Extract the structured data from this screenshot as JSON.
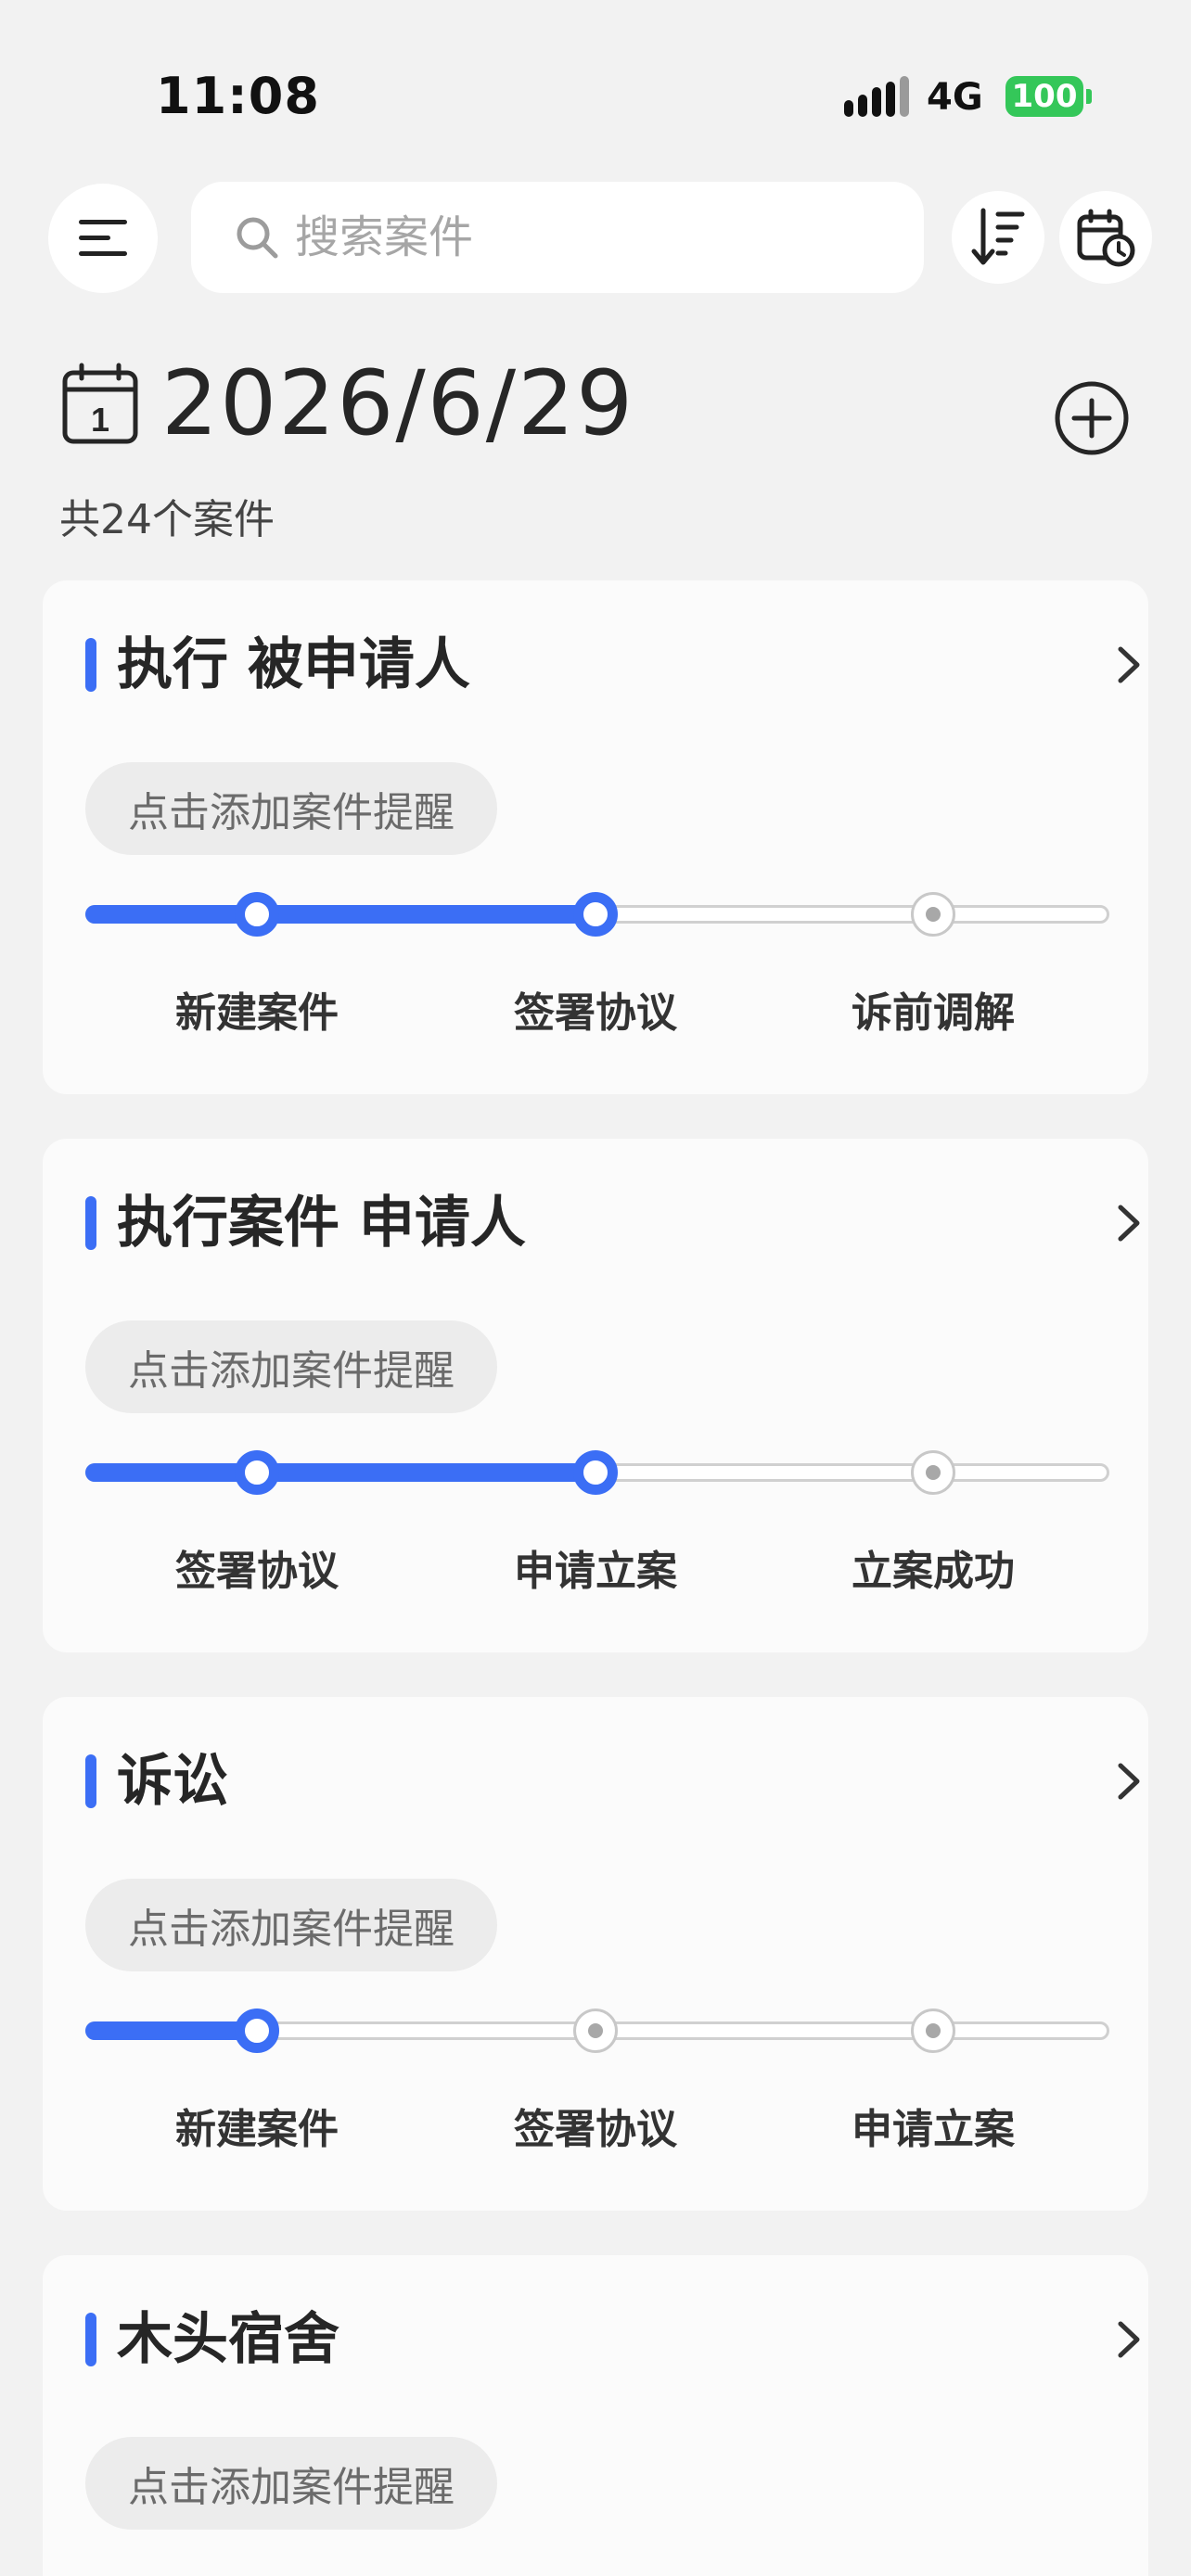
{
  "status_bar": {
    "time": "11:08",
    "network": "4G",
    "battery": "100"
  },
  "toolbar": {
    "menu_icon": "menu-icon",
    "search_placeholder": "搜索案件",
    "sort_icon": "sort-icon",
    "calendar_icon": "calendar-clock-icon"
  },
  "header": {
    "date": "2026/6/29",
    "calendar_day": "1",
    "total": "共24个案件",
    "add_icon": "plus-circle-icon"
  },
  "cases": [
    {
      "title": "执行 被申请人",
      "reminder": "点击添加案件提醒",
      "steps": [
        "新建案件",
        "签署协议",
        "诉前调解"
      ],
      "completed_steps": 2
    },
    {
      "title": "执行案件 申请人",
      "reminder": "点击添加案件提醒",
      "steps": [
        "签署协议",
        "申请立案",
        "立案成功"
      ],
      "completed_steps": 2
    },
    {
      "title": "诉讼",
      "reminder": "点击添加案件提醒",
      "steps": [
        "新建案件",
        "签署协议",
        "申请立案"
      ],
      "completed_steps": 1
    },
    {
      "title": "木头宿舍",
      "reminder": "点击添加案件提醒",
      "steps": [],
      "completed_steps": 0
    }
  ],
  "colors": {
    "accent": "#3b6ef5",
    "battery": "#34c759",
    "background": "#f2f2f2"
  }
}
